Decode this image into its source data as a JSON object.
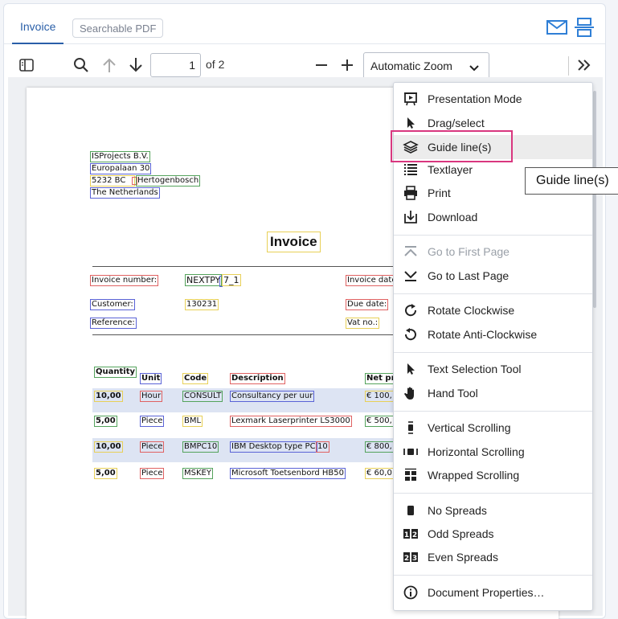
{
  "tabs": {
    "invoice": "Invoice",
    "searchable_pdf": "Searchable PDF"
  },
  "toolbar": {
    "page_number": "1",
    "page_total": "of 2",
    "zoom": "Automatic Zoom"
  },
  "document": {
    "sender": [
      "ISProjects B.V.",
      "Europalaan 30",
      "5232 BC 's-Hertogenbosch",
      "The Netherlands"
    ],
    "sender_postcode": "5232 BC",
    "sender_city": "Hertogenbosch",
    "title": "Invoice",
    "invoice_number_label": "Invoice number:",
    "invoice_number_value": "NEXTPY",
    "invoice_number_suffix": "7_1",
    "invoice_date_label": "Invoice date",
    "customer_label": "Customer:",
    "customer_value": "130231",
    "due_date_label": "Due date:",
    "reference_label": "Reference:",
    "vat_label": "Vat no.:",
    "columns": [
      "Quantity",
      "Unit",
      "Code",
      "Description",
      "Net pr"
    ],
    "rows": [
      {
        "qty": "10,00",
        "unit": "Hour",
        "code": "CONSULT",
        "desc": "Consultancy per uur",
        "price": "€ 100,"
      },
      {
        "qty": "5,00",
        "unit": "Piece",
        "code": "BML",
        "desc": "Lexmark Laserprinter LS3000",
        "price": "€ 500,"
      },
      {
        "qty": "10,00",
        "unit": "Piece",
        "code": "BMPC10",
        "desc": "IBM Desktop type PC",
        "desc_suffix": "10",
        "price": "€ 800,"
      },
      {
        "qty": "5,00",
        "unit": "Piece",
        "code": "MSKEY",
        "desc": "Microsoft Toetsenbord HB50",
        "price": "€ 60,0"
      }
    ]
  },
  "menu": {
    "items": [
      "Presentation Mode",
      "Drag/select",
      "Guide line(s)",
      "Textlayer",
      "Print",
      "Download",
      "Go to First Page",
      "Go to Last Page",
      "Rotate Clockwise",
      "Rotate Anti-Clockwise",
      "Text Selection Tool",
      "Hand Tool",
      "Vertical Scrolling",
      "Horizontal Scrolling",
      "Wrapped Scrolling",
      "No Spreads",
      "Odd Spreads",
      "Even Spreads",
      "Document Properties…"
    ]
  },
  "tooltip": "Guide line(s)",
  "colors": {
    "accent": "#2a5fa8",
    "highlight": "#d9377f",
    "box_green": "#54a35c",
    "box_blue": "#5a63d6",
    "box_yellow": "#e8d057",
    "box_red": "#e06262"
  }
}
